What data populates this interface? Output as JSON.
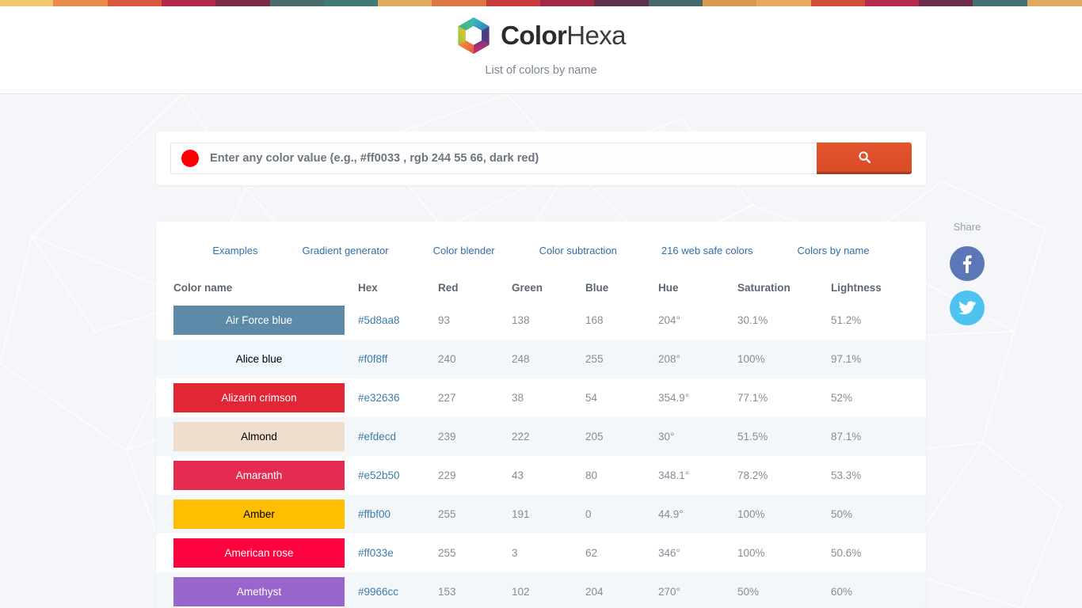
{
  "header": {
    "brand_bold": "Color",
    "brand_light": "Hexa",
    "logo_icon": "hexagon-rainbow-logo",
    "subtitle": "List of colors by name"
  },
  "search": {
    "placeholder": "Enter any color value (e.g., #ff0033 , rgb 244 55 66, dark red)",
    "value": "",
    "swatch_color": "#fe0000",
    "button_icon": "search-icon",
    "button_color": "#d94a27"
  },
  "nav": {
    "links": [
      {
        "label": "Examples"
      },
      {
        "label": "Gradient generator"
      },
      {
        "label": "Color blender"
      },
      {
        "label": "Color subtraction"
      },
      {
        "label": "216 web safe colors"
      },
      {
        "label": "Colors by name"
      }
    ]
  },
  "table": {
    "headers": [
      "Color name",
      "Hex",
      "Red",
      "Green",
      "Blue",
      "Hue",
      "Saturation",
      "Lightness"
    ],
    "rows": [
      {
        "name": "Air Force blue",
        "hex": "#5d8aa8",
        "swatch": "#5d8aa8",
        "text_color": "#ffffff",
        "red": "93",
        "green": "138",
        "blue": "168",
        "hue": "204°",
        "saturation": "30.1%",
        "lightness": "51.2%"
      },
      {
        "name": "Alice blue",
        "hex": "#f0f8ff",
        "swatch": "#f0f8ff",
        "text_color": "#000000",
        "red": "240",
        "green": "248",
        "blue": "255",
        "hue": "208°",
        "saturation": "100%",
        "lightness": "97.1%"
      },
      {
        "name": "Alizarin crimson",
        "hex": "#e32636",
        "swatch": "#e32636",
        "text_color": "#ffffff",
        "red": "227",
        "green": "38",
        "blue": "54",
        "hue": "354.9°",
        "saturation": "77.1%",
        "lightness": "52%"
      },
      {
        "name": "Almond",
        "hex": "#efdecd",
        "swatch": "#efdecd",
        "text_color": "#000000",
        "red": "239",
        "green": "222",
        "blue": "205",
        "hue": "30°",
        "saturation": "51.5%",
        "lightness": "87.1%"
      },
      {
        "name": "Amaranth",
        "hex": "#e52b50",
        "swatch": "#e52b50",
        "text_color": "#ffffff",
        "red": "229",
        "green": "43",
        "blue": "80",
        "hue": "348.1°",
        "saturation": "78.2%",
        "lightness": "53.3%"
      },
      {
        "name": "Amber",
        "hex": "#ffbf00",
        "swatch": "#ffbf00",
        "text_color": "#000000",
        "red": "255",
        "green": "191",
        "blue": "0",
        "hue": "44.9°",
        "saturation": "100%",
        "lightness": "50%"
      },
      {
        "name": "American rose",
        "hex": "#ff033e",
        "swatch": "#ff033e",
        "text_color": "#ffffff",
        "red": "255",
        "green": "3",
        "blue": "62",
        "hue": "346°",
        "saturation": "100%",
        "lightness": "50.6%"
      },
      {
        "name": "Amethyst",
        "hex": "#9966cc",
        "swatch": "#9966cc",
        "text_color": "#ffffff",
        "red": "153",
        "green": "102",
        "blue": "204",
        "hue": "270°",
        "saturation": "50%",
        "lightness": "60%"
      }
    ]
  },
  "share": {
    "label": "Share",
    "buttons": [
      {
        "name": "facebook-share-button",
        "icon": "facebook-icon",
        "color": "#5b77b5"
      },
      {
        "name": "twitter-share-button",
        "icon": "twitter-icon",
        "color": "#4ec3f0"
      }
    ]
  },
  "rainbow_strip": {
    "colors": [
      "#f2c76b",
      "#e98b4a",
      "#d9573c",
      "#b02a4a",
      "#7d2a46",
      "#4a6b6e",
      "#3f7a77",
      "#e2a85c",
      "#dd7744",
      "#c73c3c",
      "#a32847",
      "#5e3050",
      "#45696d",
      "#d99b52",
      "#e8a85e",
      "#cf4f37",
      "#b7294a",
      "#6d2c4c",
      "#437073",
      "#e0a95f"
    ]
  }
}
